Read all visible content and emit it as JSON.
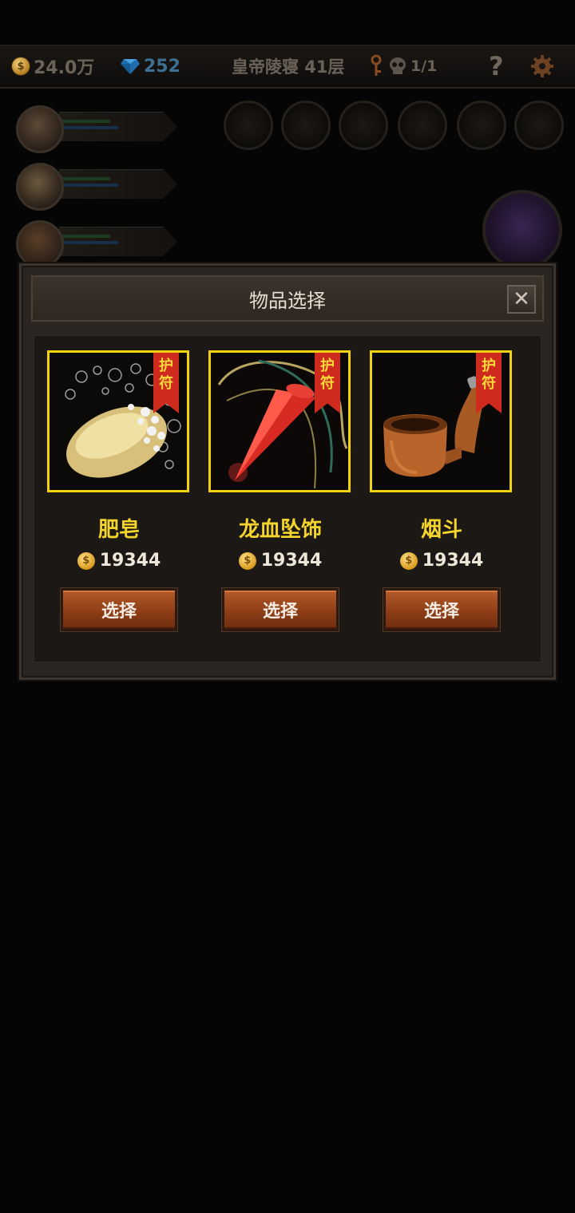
{
  "hud": {
    "gold": "24.0万",
    "gems": "252",
    "floor": "皇帝陵寝 41层",
    "keys": "1/1",
    "help_glyph": "?"
  },
  "icons": {
    "gold": "coin-icon",
    "gems": "diamond-icon",
    "key": "key-icon",
    "skull": "skull-icon",
    "help": "question-icon",
    "settings": "gear-icon"
  },
  "modal": {
    "title": "物品选择",
    "close_glyph": "✕",
    "items": [
      {
        "name": "肥皂",
        "tag_line1": "护",
        "tag_line2": "符",
        "price": "19344",
        "button": "选择",
        "icon": "soap-icon"
      },
      {
        "name": "龙血坠饰",
        "tag_line1": "护",
        "tag_line2": "符",
        "price": "19344",
        "button": "选择",
        "icon": "dragon-blood-pendant-icon"
      },
      {
        "name": "烟斗",
        "tag_line1": "护",
        "tag_line2": "符",
        "price": "19344",
        "button": "选择",
        "icon": "pipe-icon"
      }
    ]
  },
  "colors": {
    "card_border": "#f2d20f",
    "item_name": "#f5d52b",
    "ribbon": "#cf2a1e",
    "button": "#a24b1e"
  }
}
